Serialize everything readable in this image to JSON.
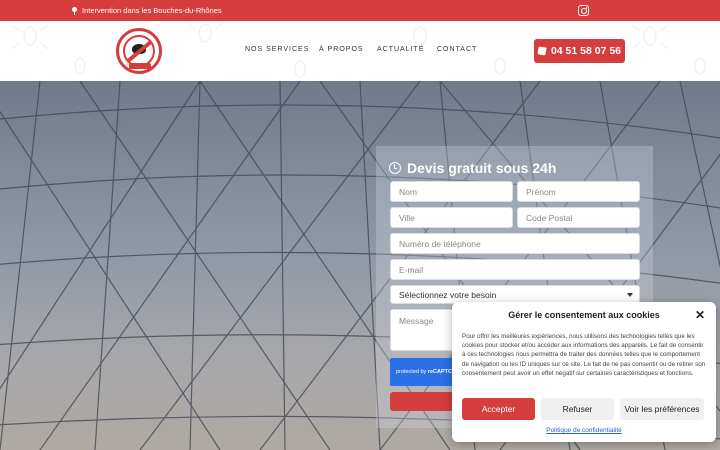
{
  "topbar": {
    "location_text": "Intervention dans les Bouches-du-Rhônes"
  },
  "header": {
    "nav": [
      "NOS SERVICES",
      "À PROPOS",
      "ACTUALITÉ",
      "CONTACT"
    ],
    "phone": "04 51 58 07 56"
  },
  "form": {
    "title": "Devis gratuit sous 24h",
    "nom_placeholder": "Nom",
    "prenom_placeholder": "Prénom",
    "ville_placeholder": "Ville",
    "code_postal_placeholder": "Code Postal",
    "telephone_placeholder": "Numéro de téléphone",
    "email_placeholder": "E-mail",
    "besoin_selected": "Sélectionnez votre besoin",
    "message_placeholder": "Message",
    "captcha_text": "protected by",
    "captcha_brand": "reCAPTC"
  },
  "consent": {
    "title": "Gérer le consentement aux cookies",
    "close_symbol": "✕",
    "text": "Pour offrir les meilleures expériences, nous utilisons des technologies telles que les cookies pour stocker et/ou accéder aux informations des appareils. Le fait de consentir à ces technologies nous permettra de traiter des données telles que le comportement de navigation ou les ID uniques sur ce site. Le fait de ne pas consentir ou de retirer son consentement peut avoir un effet négatif sur certaines caractéristiques et fonctions.",
    "accept": "Accepter",
    "refuse": "Refuser",
    "preferences": "Voir les préférences",
    "policy": "Politique de confidentialité"
  },
  "colors": {
    "brand_red": "#d63d3d",
    "link_blue": "#2a62c9"
  },
  "icons": [
    "map-pin-icon",
    "instagram-icon",
    "phone-icon",
    "clock-icon",
    "chevron-down-icon",
    "close-icon"
  ]
}
